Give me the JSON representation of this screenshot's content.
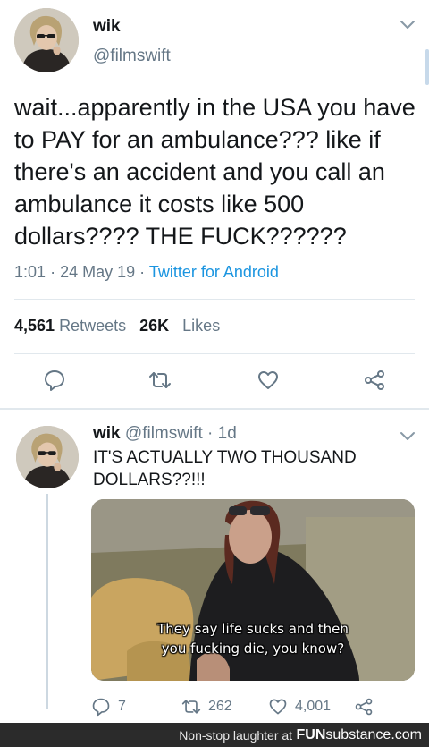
{
  "main_tweet": {
    "display_name": "wik",
    "handle": "@filmswift",
    "text": "wait...apparently in the USA you have to PAY for an ambulance??? like if there's an accident and you call an ambulance it costs like 500 dollars???? THE FUCK??????",
    "time": "1:01",
    "separator": "·",
    "date": "24 May 19",
    "source": "Twitter for Android",
    "retweets_count": "4,561",
    "retweets_label": "Retweets",
    "likes_count": "26K",
    "likes_label": "Likes",
    "actions": [
      "reply-icon",
      "retweet-icon",
      "like-icon",
      "share-icon"
    ]
  },
  "reply_tweet": {
    "display_name": "wik",
    "handle": "@filmswift",
    "separator": "·",
    "age": "1d",
    "text": "IT'S ACTUALLY TWO THOUSAND DOLLARS??!!!",
    "media_caption_line1": "They say life sucks and then",
    "media_caption_line2": "you fucking die, you know?",
    "reply_count": "7",
    "retweet_count": "262",
    "like_count": "4,001"
  },
  "footer": {
    "tagline": "Non-stop laughter at",
    "brand_main": "FUN",
    "brand_sub": "substance",
    "brand_tld": ".com"
  },
  "colors": {
    "text": "#14171a",
    "secondary": "#657786",
    "link": "#1b95e0",
    "divider": "#e1e8ed",
    "footer_bg": "#2b2b2b"
  }
}
